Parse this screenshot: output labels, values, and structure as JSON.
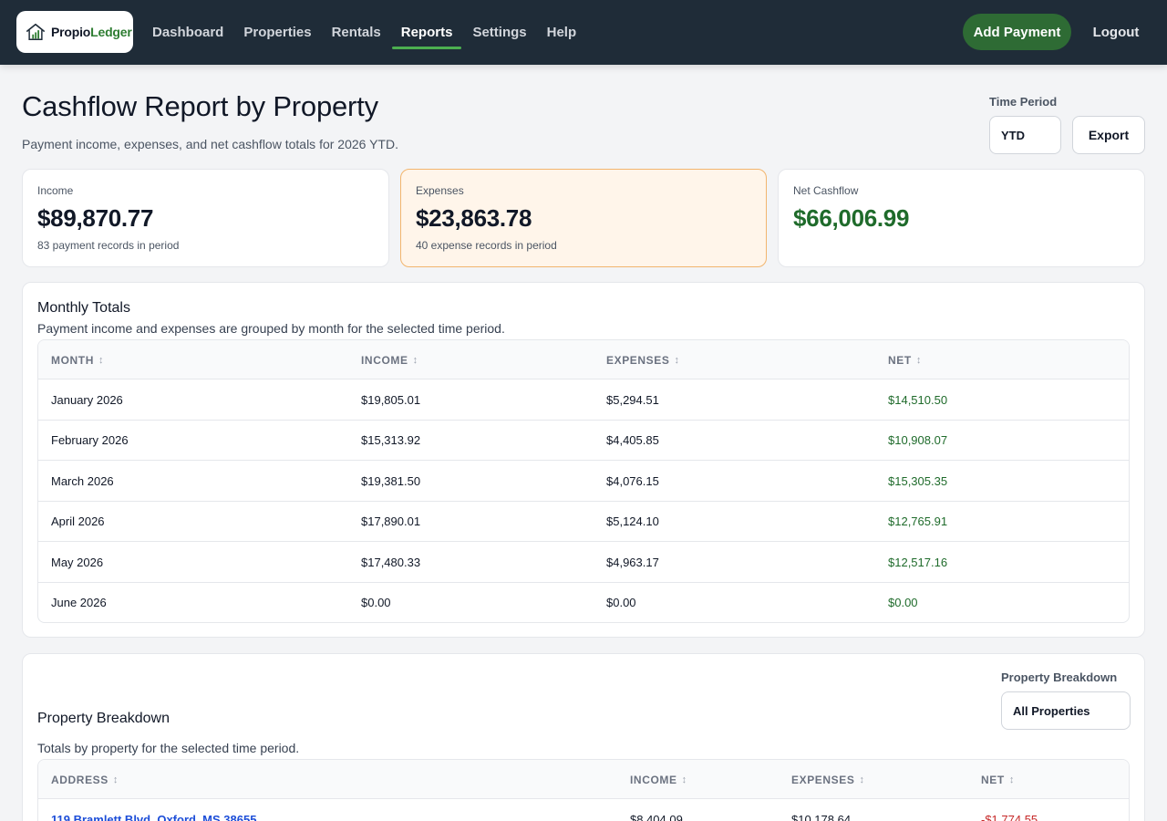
{
  "app": {
    "logo_main": "Propio",
    "logo_accent": "Ledger"
  },
  "nav": {
    "links": [
      "Dashboard",
      "Properties",
      "Rentals",
      "Reports",
      "Settings",
      "Help"
    ],
    "active": "Reports",
    "add_payment": "Add Payment",
    "logout": "Logout"
  },
  "header": {
    "title": "Cashflow Report by Property",
    "subtitle": "Payment income, expenses, and net cashflow totals for 2026 YTD.",
    "time_period_label": "Time Period",
    "time_period_value": "YTD",
    "export": "Export"
  },
  "cards": {
    "income": {
      "label": "Income",
      "value": "$89,870.77",
      "note": "83 payment records in period"
    },
    "expenses": {
      "label": "Expenses",
      "value": "$23,863.78",
      "note": "40 expense records in period"
    },
    "net": {
      "label": "Net Cashflow",
      "value": "$66,006.99"
    }
  },
  "monthly": {
    "title": "Monthly Totals",
    "description": "Payment income and expenses are grouped by month for the selected time period.",
    "columns": [
      "MONTH",
      "INCOME",
      "EXPENSES",
      "NET"
    ],
    "sort_glyph": "↕",
    "rows": [
      {
        "month": "January 2026",
        "income": "$19,805.01",
        "expenses": "$5,294.51",
        "net": "$14,510.50"
      },
      {
        "month": "February 2026",
        "income": "$15,313.92",
        "expenses": "$4,405.85",
        "net": "$10,908.07"
      },
      {
        "month": "March 2026",
        "income": "$19,381.50",
        "expenses": "$4,076.15",
        "net": "$15,305.35"
      },
      {
        "month": "April 2026",
        "income": "$17,890.01",
        "expenses": "$5,124.10",
        "net": "$12,765.91"
      },
      {
        "month": "May 2026",
        "income": "$17,480.33",
        "expenses": "$4,963.17",
        "net": "$12,517.16"
      },
      {
        "month": "June 2026",
        "income": "$0.00",
        "expenses": "$0.00",
        "net": "$0.00"
      }
    ]
  },
  "breakdown": {
    "title": "Property Breakdown",
    "description": "Totals by property for the selected time period.",
    "filter_label": "Property Breakdown",
    "filter_value": "All Properties",
    "columns": [
      "ADDRESS",
      "INCOME",
      "EXPENSES",
      "NET"
    ],
    "rows": [
      {
        "address": "119 Bramlett Blvd, Oxford, MS 38655",
        "income": "$8,404.09",
        "expenses": "$10,178.64",
        "net": "-$1,774.55"
      }
    ]
  },
  "colors": {
    "nav_bg": "#1f2c38",
    "accent_green": "#2e6b34",
    "net_green": "#1f6b2b",
    "negative_red": "#c62828",
    "link_blue": "#1d4ed8",
    "expense_card_bg": "#fff5ea"
  }
}
